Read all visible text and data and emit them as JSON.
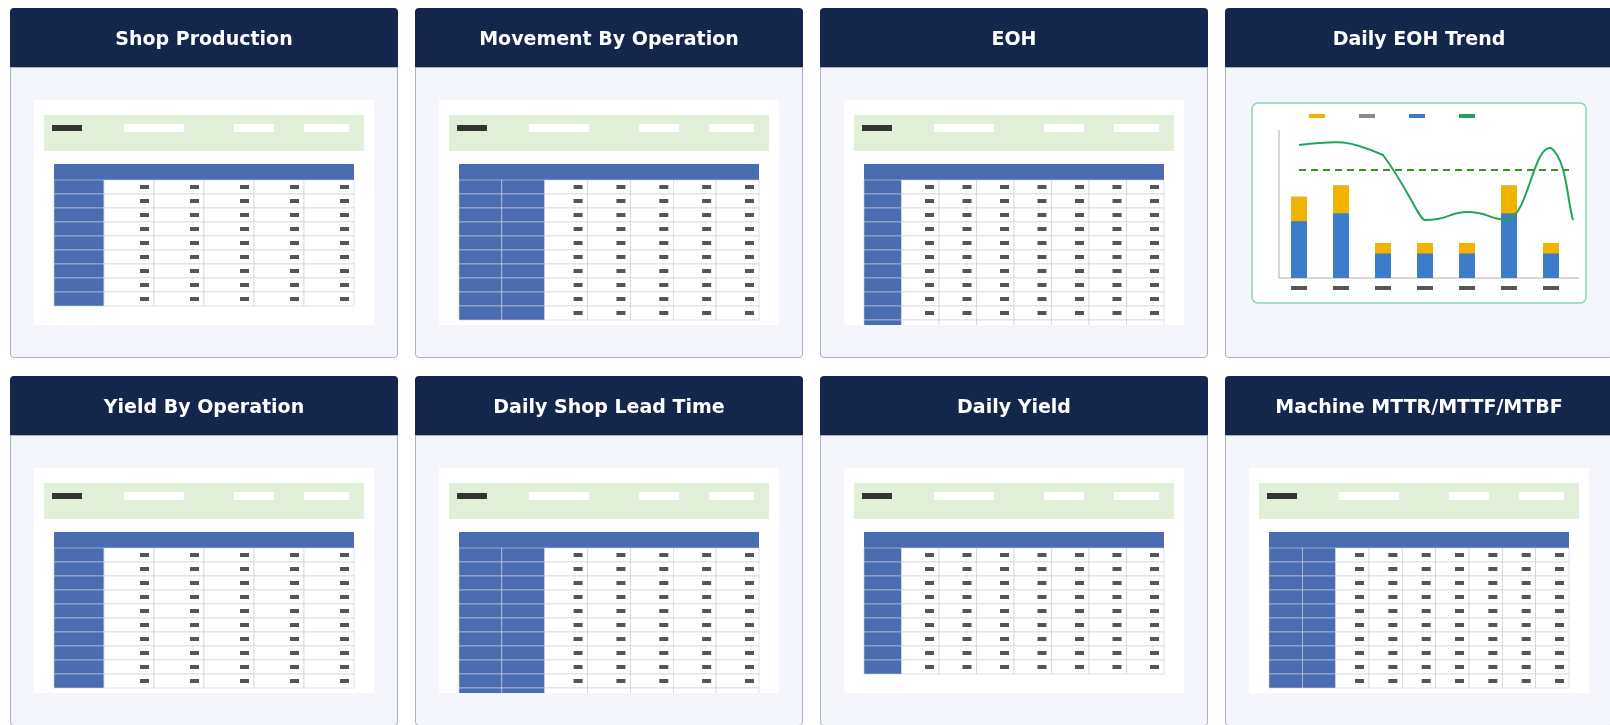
{
  "cards": [
    {
      "title": "Shop Production",
      "kind": "table"
    },
    {
      "title": "Movement By Operation",
      "kind": "table"
    },
    {
      "title": "EOH",
      "kind": "table"
    },
    {
      "title": "Daily EOH Trend",
      "kind": "chart"
    },
    {
      "title": "Yield By Operation",
      "kind": "table"
    },
    {
      "title": "Daily Shop Lead Time",
      "kind": "table"
    },
    {
      "title": "Daily Yield",
      "kind": "table"
    },
    {
      "title": "Machine MTTR/MTTF/MTBF",
      "kind": "table"
    }
  ]
}
